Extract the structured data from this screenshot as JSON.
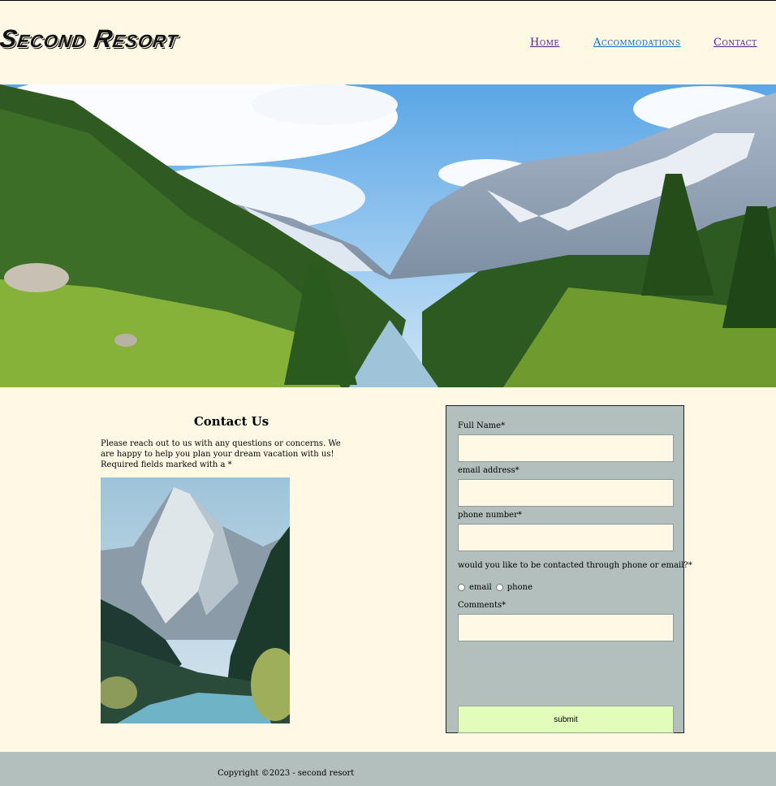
{
  "header": {
    "brand": "Second Resort",
    "nav": {
      "home": "Home",
      "accommodations": "Accommodations",
      "contact": "Contact"
    }
  },
  "contact": {
    "title": "Contact Us",
    "text": "Please reach out to us with any questions or concerns. We are happy to help you plan your dream vacation with us! Required fields marked with a *"
  },
  "form": {
    "full_name_label": "Full Name*",
    "email_label": "email address*",
    "phone_label": "phone number*",
    "contact_pref_label": "would you like to be contacted through phone or email?*",
    "option_email": "email",
    "option_phone": "phone",
    "comments_label": "Comments*",
    "submit": "submit"
  },
  "footer": {
    "copyright": "Copyright ©2023 - second resort"
  },
  "colors": {
    "background": "#fff8e5",
    "form_bg": "#b2bfbc",
    "submit_bg": "#e1fcbb"
  }
}
